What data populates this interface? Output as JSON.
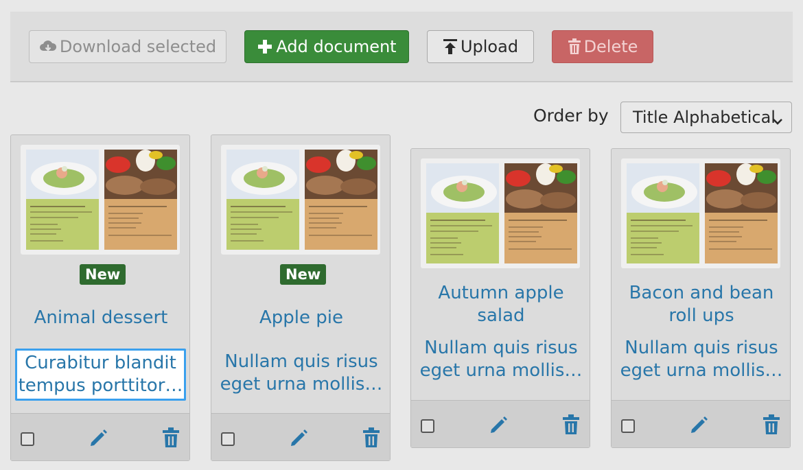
{
  "toolbar": {
    "download_label": "Download selected",
    "add_label": "Add document",
    "upload_label": "Upload",
    "delete_label": "Delete"
  },
  "sort": {
    "label": "Order by",
    "selected": "Title Alphabetical"
  },
  "cards": [
    {
      "title": "Animal dessert",
      "badge": "New",
      "description": "Curabitur blandit tempus porttitor…"
    },
    {
      "title": "Apple pie",
      "badge": "New",
      "description": "Nullam quis risus eget urna mollis…"
    },
    {
      "title": "Autumn apple salad",
      "badge": "",
      "description": "Nullam quis risus eget urna mollis…"
    },
    {
      "title": "Bacon and bean roll ups",
      "badge": "",
      "description": "Nullam quis risus eget urna mollis…"
    }
  ],
  "thumbnail": {
    "page1_heading": "Duis mollis, est non commodo luctus",
    "page2_heading": "Donec id elit non mi porta gravida"
  },
  "colors": {
    "add": "#3a8c3a",
    "delete": "#c86565",
    "link": "#2876a9",
    "badge": "#2f6b2f",
    "focus": "#3aa0ee"
  },
  "icons": {
    "download": "cloud-download-icon",
    "add": "plus-icon",
    "upload": "upload-icon",
    "delete": "trash-icon",
    "edit": "pencil-icon",
    "select": "chevron-down-icon"
  }
}
